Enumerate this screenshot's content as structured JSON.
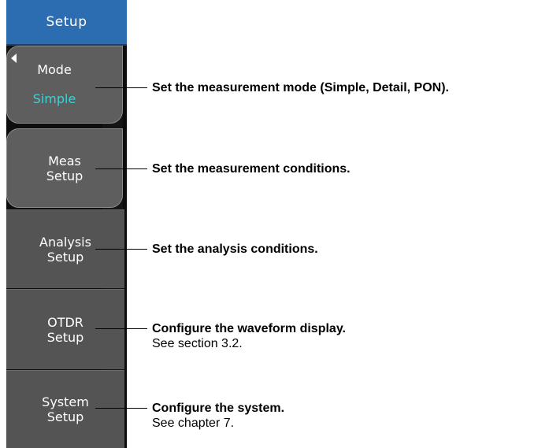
{
  "menu": {
    "title": "Setup",
    "items": [
      {
        "label": "Mode",
        "value": "Simple"
      },
      {
        "label_line1": "Meas",
        "label_line2": "Setup"
      },
      {
        "label_line1": "Analysis",
        "label_line2": "Setup"
      },
      {
        "label_line1": "OTDR",
        "label_line2": "Setup"
      },
      {
        "label_line1": "System",
        "label_line2": "Setup"
      }
    ]
  },
  "descriptions": [
    {
      "title": "Set the measurement mode (Simple, Detail, PON)."
    },
    {
      "title": "Set the measurement conditions."
    },
    {
      "title": "Set the analysis conditions."
    },
    {
      "title": "Configure the waveform display.",
      "sub": "See section 3.2."
    },
    {
      "title": "Configure the system.",
      "sub": "See chapter 7."
    }
  ],
  "colors": {
    "header": "#2c6cb0",
    "mode_value": "#3fd0d4",
    "key": "#525252"
  },
  "icons": {
    "mode_marker": "left-triangle-icon"
  }
}
